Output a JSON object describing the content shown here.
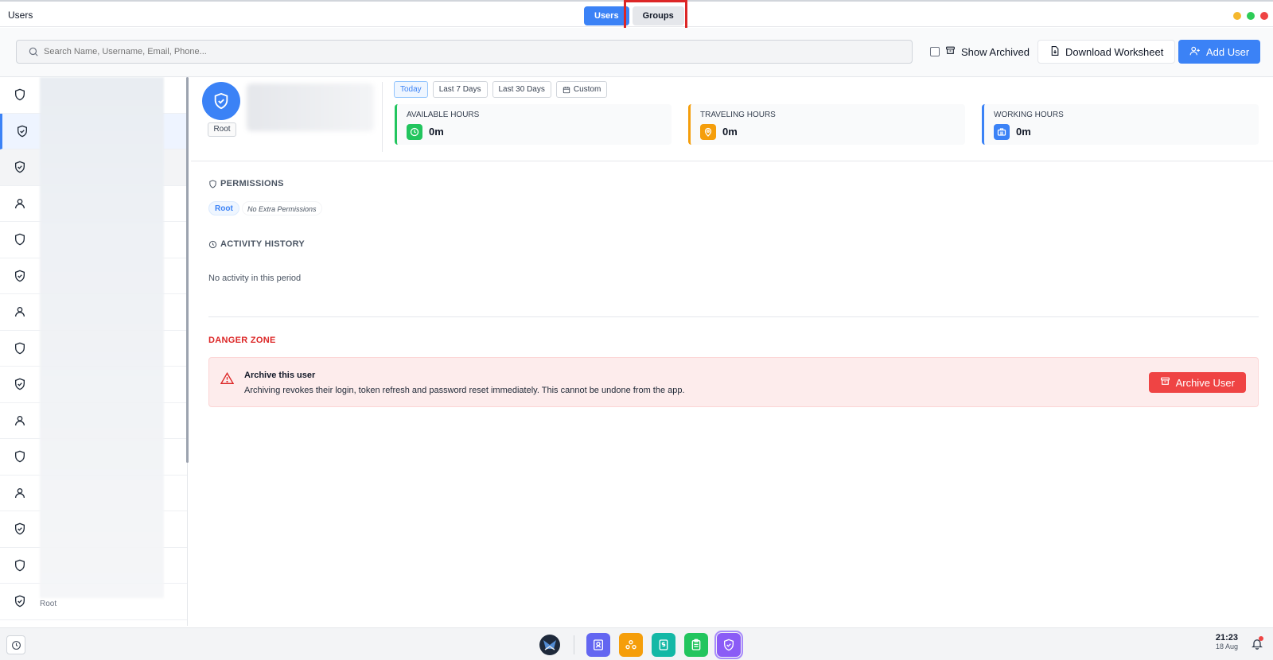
{
  "app": {
    "title": "Users"
  },
  "tabs": [
    {
      "label": "Users",
      "active": true
    },
    {
      "label": "Groups",
      "active": false
    }
  ],
  "window_controls": {
    "minimize_color": "#f5b82e",
    "maximize_color": "#2ecc57",
    "close_color": "#ef4444"
  },
  "toolbar": {
    "search_placeholder": "Search Name, Username, Email, Phone...",
    "show_archived_label": "Show Archived",
    "show_archived_checked": false,
    "download_label": "Download Worksheet",
    "add_user_label": "Add User"
  },
  "user_list": {
    "rows": [
      {
        "icon": "shield-icon"
      },
      {
        "icon": "shield-check-icon",
        "selected": true
      },
      {
        "icon": "shield-check-icon"
      },
      {
        "icon": "user-icon"
      },
      {
        "icon": "shield-icon"
      },
      {
        "icon": "shield-check-icon"
      },
      {
        "icon": "user-icon"
      },
      {
        "icon": "shield-icon"
      },
      {
        "icon": "shield-check-icon"
      },
      {
        "icon": "user-icon"
      },
      {
        "icon": "shield-icon"
      },
      {
        "icon": "user-icon"
      },
      {
        "icon": "shield-check-icon"
      },
      {
        "icon": "shield-icon"
      },
      {
        "icon": "shield-check-icon"
      }
    ],
    "footer_role": "Root"
  },
  "profile": {
    "role": "Root",
    "date_ranges": [
      "Today",
      "Last 7 Days",
      "Last 30 Days",
      "Custom"
    ],
    "active_range": "Today",
    "stats": [
      {
        "label": "AVAILABLE HOURS",
        "value": "0m",
        "color": "#22c55e",
        "icon": "clock-icon"
      },
      {
        "label": "TRAVELING HOURS",
        "value": "0m",
        "color": "#f59e0b",
        "icon": "map-pin-icon"
      },
      {
        "label": "WORKING HOURS",
        "value": "0m",
        "color": "#3b82f6",
        "icon": "briefcase-icon"
      }
    ]
  },
  "permissions": {
    "title": "PERMISSIONS",
    "role_chip": "Root",
    "extra": "No Extra Permissions"
  },
  "activity": {
    "title": "ACTIVITY HISTORY",
    "empty_text": "No activity in this period"
  },
  "danger_zone": {
    "title": "DANGER ZONE",
    "card_title": "Archive this user",
    "card_desc": "Archiving revokes their login, token refresh and password reset immediately. This cannot be undone from the app.",
    "button_label": "Archive User"
  },
  "taskbar": {
    "time": "21:23",
    "date": "18 Aug",
    "apps": [
      {
        "name": "contacts-app-icon",
        "color": "#6366f1"
      },
      {
        "name": "groups-app-icon",
        "color": "#f59e0b"
      },
      {
        "name": "billing-app-icon",
        "color": "#14b8a6"
      },
      {
        "name": "tasks-app-icon",
        "color": "#22c55e"
      },
      {
        "name": "users-app-icon",
        "color": "#8b5cf6",
        "active": true
      }
    ]
  }
}
